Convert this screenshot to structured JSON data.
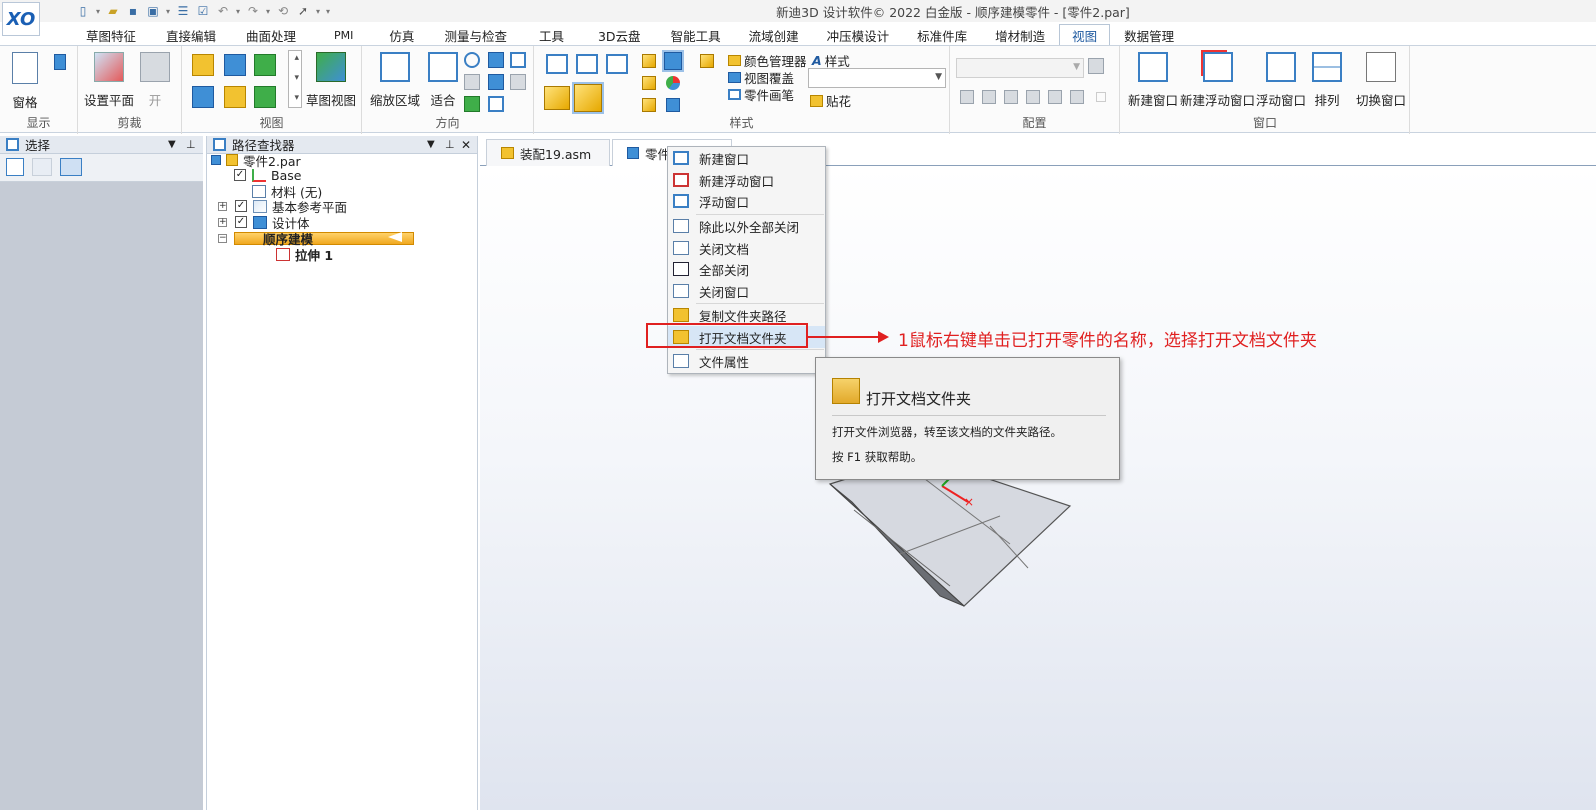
{
  "app": {
    "title": "新迪3D 设计软件© 2022 白金版 - 顺序建模零件 - [零件2.par]"
  },
  "ribbon_tabs": [
    {
      "label": "草图特征",
      "active": false
    },
    {
      "label": "直接编辑",
      "active": false
    },
    {
      "label": "曲面处理",
      "active": false
    },
    {
      "label": "PMI",
      "active": false
    },
    {
      "label": "仿真",
      "active": false
    },
    {
      "label": "测量与检查",
      "active": false
    },
    {
      "label": "工具",
      "active": false
    },
    {
      "label": "3D云盘",
      "active": false
    },
    {
      "label": "智能工具",
      "active": false
    },
    {
      "label": "流域创建",
      "active": false
    },
    {
      "label": "冲压模设计",
      "active": false
    },
    {
      "label": "标准件库",
      "active": false
    },
    {
      "label": "增材制造",
      "active": false
    },
    {
      "label": "视图",
      "active": true
    },
    {
      "label": "数据管理",
      "active": false
    }
  ],
  "ribbon": {
    "show_group": {
      "label": "显示",
      "pane_button": "窗格"
    },
    "clip_group": {
      "label": "剪裁",
      "set_plane": "设置平面",
      "open": "开"
    },
    "view_group": {
      "label": "视图",
      "sketch_view": "草图视图"
    },
    "orient_group": {
      "label": "方向",
      "zoom_area": "缩放区域",
      "fit": "适合"
    },
    "style_group": {
      "label": "样式",
      "color_manager": "颜色管理器",
      "style": "样式",
      "view_overlay": "视图覆盖",
      "part_pen": "零件画笔",
      "decal": "贴花"
    },
    "config_group": {
      "label": "配置"
    },
    "window_group": {
      "label": "窗口",
      "new_window": "新建窗口",
      "new_float_window": "新建浮动窗口",
      "float_window": "浮动窗口",
      "arrange": "排列",
      "switch_window": "切换窗口"
    }
  },
  "select_panel": {
    "title": "选择"
  },
  "pathfinder": {
    "title": "路径查找器",
    "items": [
      {
        "label": "零件2.par"
      },
      {
        "label": "Base"
      },
      {
        "label": "材料 (无)"
      },
      {
        "label": "基本参考平面"
      },
      {
        "label": "设计体"
      },
      {
        "label": "顺序建模"
      },
      {
        "label": "拉伸 1"
      }
    ]
  },
  "doc_tabs": [
    {
      "label": "装配19.asm",
      "active": false
    },
    {
      "label": "零件",
      "active": true
    }
  ],
  "context_menu": {
    "items": [
      {
        "label": "新建窗口"
      },
      {
        "label": "新建浮动窗口"
      },
      {
        "label": "浮动窗口"
      },
      {
        "label": "除此以外全部关闭"
      },
      {
        "label": "关闭文档"
      },
      {
        "label": "全部关闭"
      },
      {
        "label": "关闭窗口"
      },
      {
        "label": "复制文件夹路径"
      },
      {
        "label": "打开文档文件夹"
      },
      {
        "label": "文件属性"
      }
    ]
  },
  "annotation": {
    "text": "1鼠标右键单击已打开零件的名称，选择打开文档文件夹",
    "color": "#e02020"
  },
  "tooltip": {
    "title": "打开文档文件夹",
    "description": "打开文件浏览器，转至该文档的文件夹路径。",
    "help": "按 F1 获取帮助。"
  },
  "colors": {
    "accent": "#1f5aa0",
    "highlight": "#f0a820"
  }
}
